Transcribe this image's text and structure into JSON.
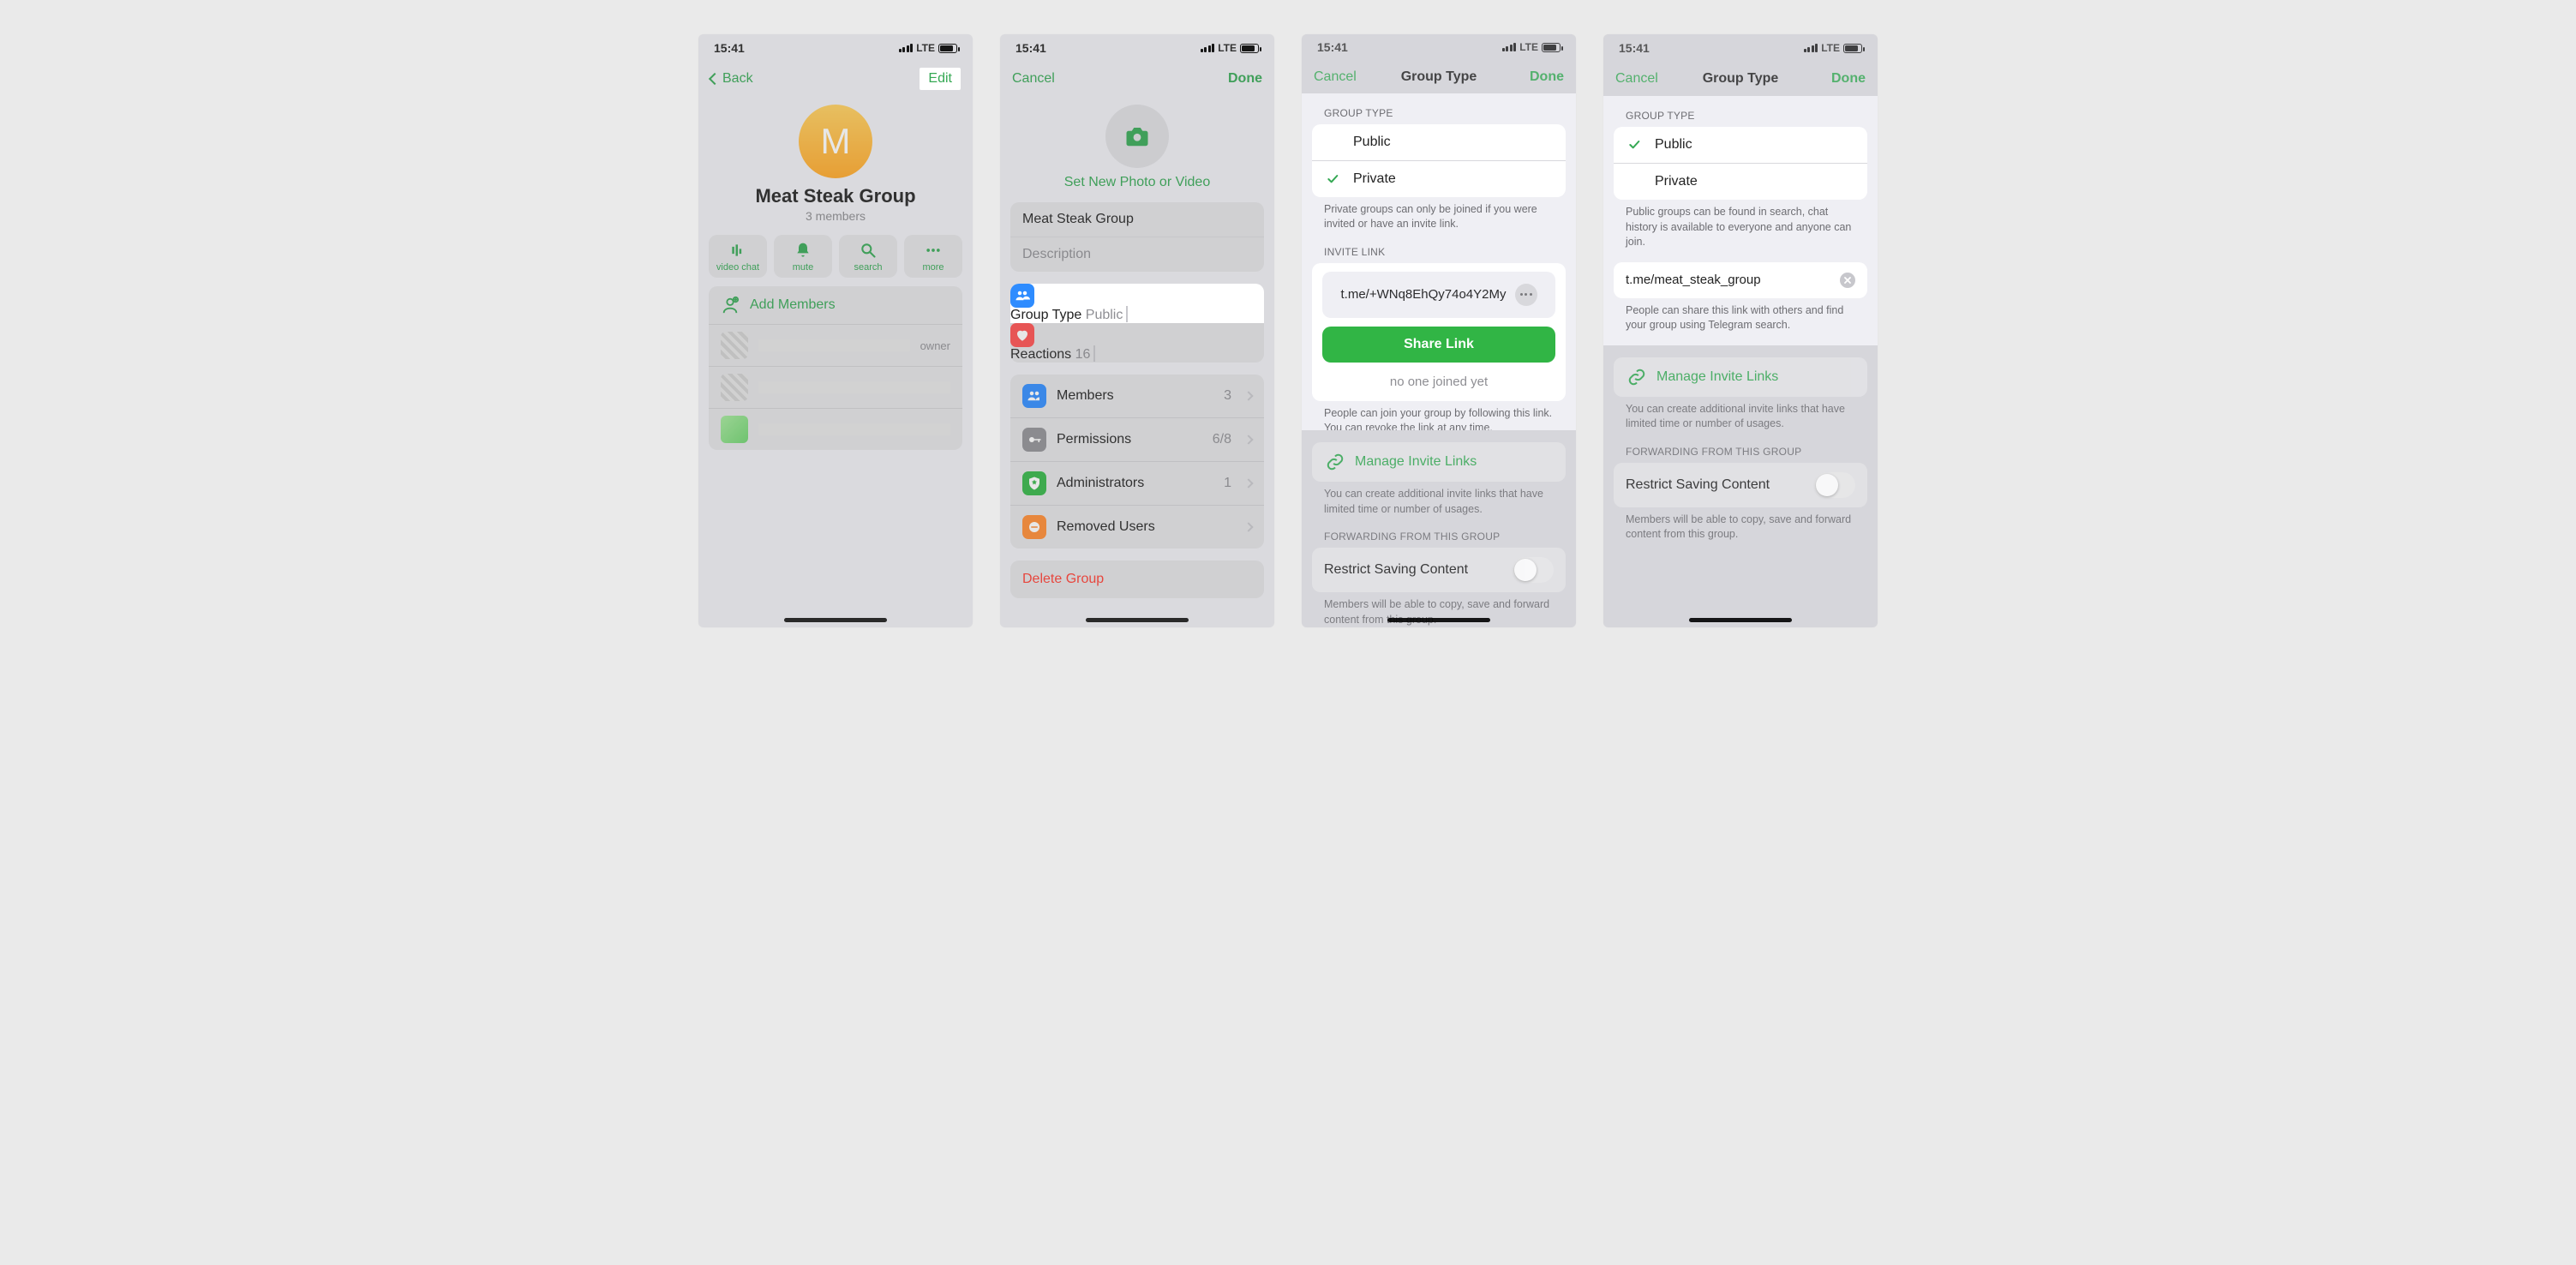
{
  "status": {
    "time": "15:41",
    "net": "LTE"
  },
  "s1": {
    "back": "Back",
    "edit": "Edit",
    "avatar_letter": "M",
    "title": "Meat Steak Group",
    "subtitle": "3 members",
    "actions": [
      "video chat",
      "mute",
      "search",
      "more"
    ],
    "add_members": "Add Members",
    "owner_tag": "owner"
  },
  "s2": {
    "cancel": "Cancel",
    "done": "Done",
    "set_photo": "Set New Photo or Video",
    "name_value": "Meat Steak Group",
    "desc_placeholder": "Description",
    "rows": {
      "group_type": {
        "label": "Group Type",
        "value": "Public"
      },
      "reactions": {
        "label": "Reactions",
        "value": "16"
      },
      "members": {
        "label": "Members",
        "value": "3"
      },
      "permissions": {
        "label": "Permissions",
        "value": "6/8"
      },
      "admins": {
        "label": "Administrators",
        "value": "1"
      },
      "removed": {
        "label": "Removed Users",
        "value": ""
      }
    },
    "delete": "Delete Group"
  },
  "s3": {
    "cancel": "Cancel",
    "title": "Group Type",
    "done": "Done",
    "section_group_type": "GROUP TYPE",
    "public": "Public",
    "private": "Private",
    "private_selected": true,
    "group_type_footer": "Private groups can only be joined if you were invited or have an invite link.",
    "section_invite": "INVITE LINK",
    "invite_link": "t.me/+WNq8EhQy74o4Y2My",
    "share": "Share Link",
    "noone": "no one joined yet",
    "invite_footer": "People can join your group by following this link. You can revoke the link at any time.",
    "manage": "Manage Invite Links",
    "manage_footer": "You can create additional invite links that have limited time or number of usages.",
    "section_forward": "FORWARDING FROM THIS GROUP",
    "restrict": "Restrict Saving Content",
    "restrict_footer": "Members will be able to copy, save and forward content from this group."
  },
  "s4": {
    "cancel": "Cancel",
    "title": "Group Type",
    "done": "Done",
    "section_group_type": "GROUP TYPE",
    "public": "Public",
    "private": "Private",
    "public_selected": true,
    "group_type_footer": "Public groups can be found in search, chat history is available to everyone and anyone can join.",
    "link_value": "t.me/meat_steak_group",
    "link_footer": "People can share this link with others and find your group using Telegram search.",
    "manage": "Manage Invite Links",
    "manage_footer": "You can create additional invite links that have limited time or number of usages.",
    "section_forward": "FORWARDING FROM THIS GROUP",
    "restrict": "Restrict Saving Content",
    "restrict_footer": "Members will be able to copy, save and forward content from this group."
  }
}
